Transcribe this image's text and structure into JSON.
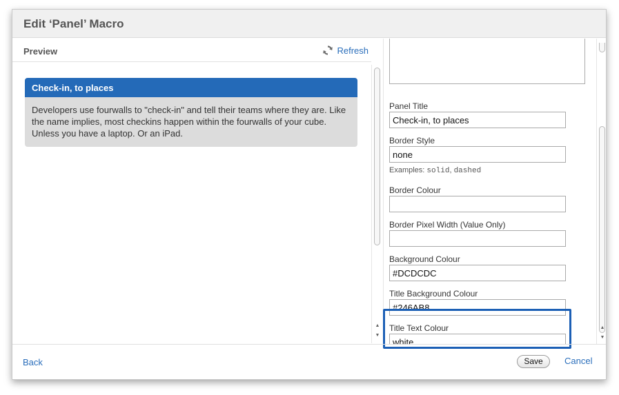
{
  "dialog": {
    "title": "Edit ‘Panel’ Macro"
  },
  "preview": {
    "label": "Preview",
    "refresh_label": "Refresh",
    "refresh_icon": "refresh-icon",
    "panel": {
      "title": "Check-in, to places",
      "body": "Developers use fourwalls to \"check-in\" and tell their teams where they are. Like the name implies, most checkins happen within the fourwalls of your cube. Unless you have a laptop. Or an iPad."
    }
  },
  "form": {
    "panel_title": {
      "label": "Panel Title",
      "value": "Check-in, to places"
    },
    "border_style": {
      "label": "Border Style",
      "value": "none",
      "examples_prefix": "Examples: ",
      "example1": "solid",
      "separator": ", ",
      "example2": "dashed"
    },
    "border_colour": {
      "label": "Border Colour",
      "value": ""
    },
    "border_pixel_width": {
      "label": "Border Pixel Width (Value Only)",
      "value": ""
    },
    "background_colour": {
      "label": "Background Colour",
      "value": "#DCDCDC"
    },
    "title_background_colour": {
      "label": "Title Background Colour",
      "value": "#246AB8"
    },
    "title_text_colour": {
      "label": "Title Text Colour",
      "value": "white"
    }
  },
  "footer": {
    "back_label": "Back",
    "save_label": "Save",
    "cancel_label": "Cancel"
  },
  "colors": {
    "panel_background": "#DCDCDC",
    "panel_title_background": "#246AB8",
    "link": "#2a6ebb",
    "highlight": "#1b5fb5"
  }
}
